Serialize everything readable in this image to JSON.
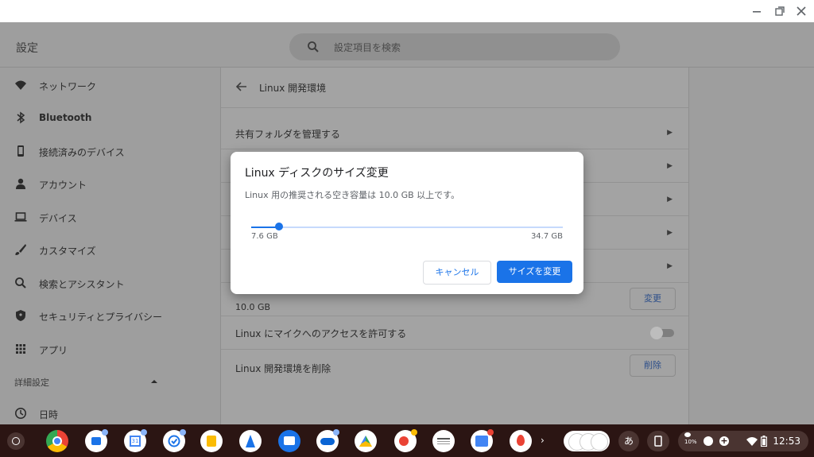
{
  "window": {
    "minimize_icon": "minimize-icon",
    "maximize_icon": "maximize-icon",
    "close_icon": "close-icon"
  },
  "header": {
    "title": "設定",
    "search_placeholder": "設定項目を検索"
  },
  "sidebar": {
    "items": [
      {
        "label": "ネットワーク",
        "icon": "wifi-icon"
      },
      {
        "label": "Bluetooth",
        "icon": "bluetooth-icon"
      },
      {
        "label": "接続済みのデバイス",
        "icon": "phone-icon"
      },
      {
        "label": "アカウント",
        "icon": "person-icon"
      },
      {
        "label": "デバイス",
        "icon": "laptop-icon"
      },
      {
        "label": "カスタマイズ",
        "icon": "brush-icon"
      },
      {
        "label": "検索とアシスタント",
        "icon": "search-icon"
      },
      {
        "label": "セキュリティとプライバシー",
        "icon": "shield-icon"
      },
      {
        "label": "アプリ",
        "icon": "apps-grid-icon"
      }
    ],
    "advanced_label": "詳細設定",
    "datetime_label": "日時"
  },
  "main": {
    "page_title": "Linux 開発環境",
    "rows": {
      "shared_folders": "共有フォルダを管理する",
      "disk_size_value": "10.0 GB",
      "change_button": "変更",
      "mic_access": "Linux にマイクへのアクセスを許可する",
      "remove": "Linux 開発環境を削除",
      "remove_button": "削除"
    },
    "mic_toggle_on": false
  },
  "dialog": {
    "title": "Linux ディスクのサイズ変更",
    "description": "Linux 用の推奨される空き容量は 10.0 GB 以上です。",
    "slider": {
      "min_label": "7.6 GB",
      "max_label": "34.7 GB",
      "min": 7.6,
      "max": 34.7,
      "value": 10.0
    },
    "cancel_label": "キャンセル",
    "confirm_label": "サイズを変更"
  },
  "shelf": {
    "ime_label": "あ",
    "battery_percent": "10%",
    "time": "12:53"
  },
  "colors": {
    "accent": "#1a73e8",
    "shelf": "#2b1513",
    "scrim": "#9e9e9e"
  }
}
